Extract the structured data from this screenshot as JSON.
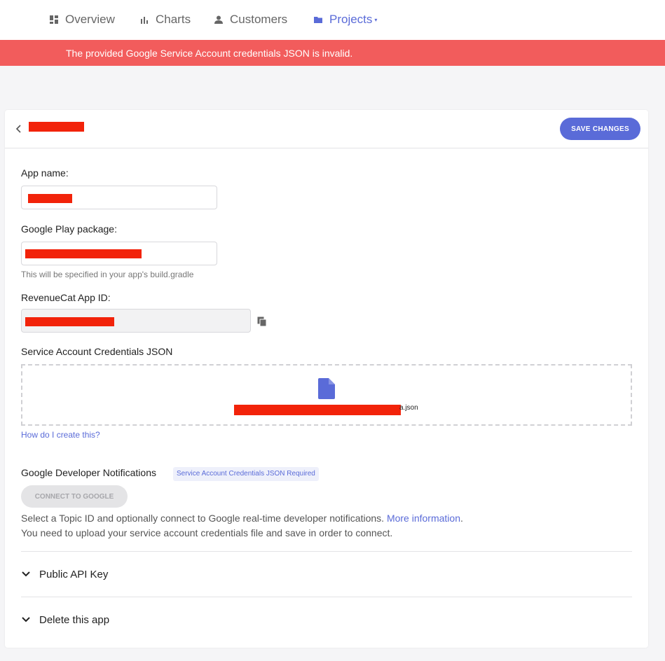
{
  "nav": {
    "items": [
      {
        "label": "Overview",
        "icon": "dashboard-icon"
      },
      {
        "label": "Charts",
        "icon": "bar-chart-icon"
      },
      {
        "label": "Customers",
        "icon": "person-icon"
      },
      {
        "label": "Projects",
        "icon": "folder-icon",
        "active": true
      }
    ],
    "dropdown_caret": "▾"
  },
  "error_banner": {
    "message": "The provided Google Service Account credentials JSON is invalid."
  },
  "header": {
    "save_label": "SAVE CHANGES"
  },
  "form": {
    "app_name_label": "App name:",
    "package_label": "Google Play package:",
    "package_hint": "This will be specified in your app's build.gradle",
    "app_id_label": "RevenueCat App ID:",
    "credentials_label": "Service Account Credentials JSON",
    "credentials_file_suffix": "a.json",
    "how_to_link": "How do I create this?"
  },
  "notifications": {
    "title": "Google Developer Notifications",
    "badge": "Service Account Credentials JSON Required",
    "connect_label": "CONNECT TO GOOGLE",
    "desc_line1": "Select a Topic ID and optionally connect to Google real-time developer notifications.",
    "more_link": "More information",
    "desc_line1_end": ".",
    "desc_line2": "You need to upload your service account credentials file and save in order to connect."
  },
  "sections": {
    "public_api_key": "Public API Key",
    "delete_app": "Delete this app"
  },
  "colors": {
    "accent": "#5a6bd8",
    "error": "#f25c5c",
    "redaction": "#f2230a"
  }
}
